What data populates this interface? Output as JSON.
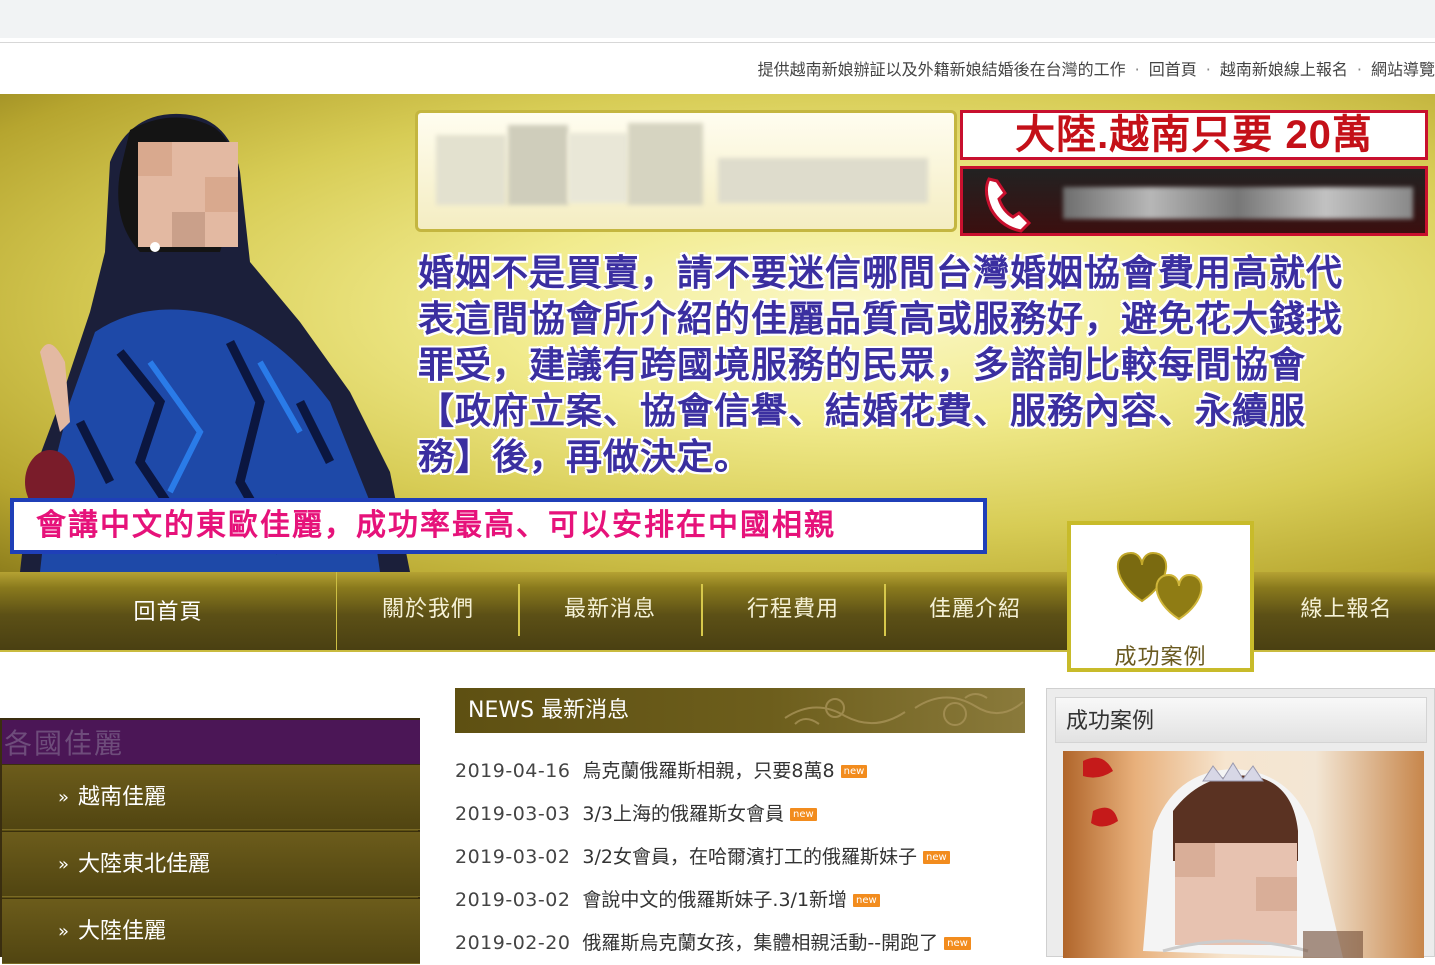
{
  "toplinks": {
    "tagline": "提供越南新娘辦証以及外籍新娘結婚後在台灣的工作",
    "home": "回首頁",
    "signup": "越南新娘線上報名",
    "sitemap": "網站導覽",
    "separator": "·"
  },
  "banner": {
    "price": "大陸.越南只要 20萬",
    "headline": "婚姻不是買賣，請不要迷信哪間台灣婚姻協會費用高就代表這間協會所介紹的佳麗品質高或服務好，避免花大錢找罪受，建議有跨國境服務的民眾，多諮詢比較每間協會【政府立案、協會信譽、結婚花費、服務內容、永續服務】後，再做決定。",
    "slogan": "會講中文的東歐佳麗，成功率最高、可以安排在中國相親"
  },
  "nav": {
    "home": "回首頁",
    "about": "關於我們",
    "news": "最新消息",
    "fees": "行程費用",
    "ladies": "佳麗介紹",
    "success": "成功案例",
    "signup": "線上報名"
  },
  "sidebar": {
    "title": "各國佳麗",
    "items": [
      {
        "label": "越南佳麗"
      },
      {
        "label": "大陸東北佳麗"
      },
      {
        "label": "大陸佳麗"
      }
    ]
  },
  "news": {
    "header_en": "NEWS",
    "header_zh": "最新消息",
    "badge": "new",
    "items": [
      {
        "date": "2019-04-16",
        "title": "烏克蘭俄羅斯相親，只要8萬8"
      },
      {
        "date": "2019-03-03",
        "title": "3/3上海的俄羅斯女會員"
      },
      {
        "date": "2019-03-02",
        "title": "3/2女會員，在哈爾濱打工的俄羅斯妹子"
      },
      {
        "date": "2019-03-02",
        "title": "會說中文的俄羅斯妹子.3/1新增"
      },
      {
        "date": "2019-02-20",
        "title": "俄羅斯烏克蘭女孩，集體相親活動--開跑了"
      }
    ]
  },
  "right_panel": {
    "title": "成功案例"
  },
  "colors": {
    "nav_bg": "#5c5016",
    "accent_gold": "#c9bb3f",
    "price_red": "#c41018",
    "headline_blue": "#3b2fa0",
    "slogan_pink": "#e6127a",
    "sidebar_title": "#4b1656",
    "badge_orange": "#f28c1e"
  }
}
